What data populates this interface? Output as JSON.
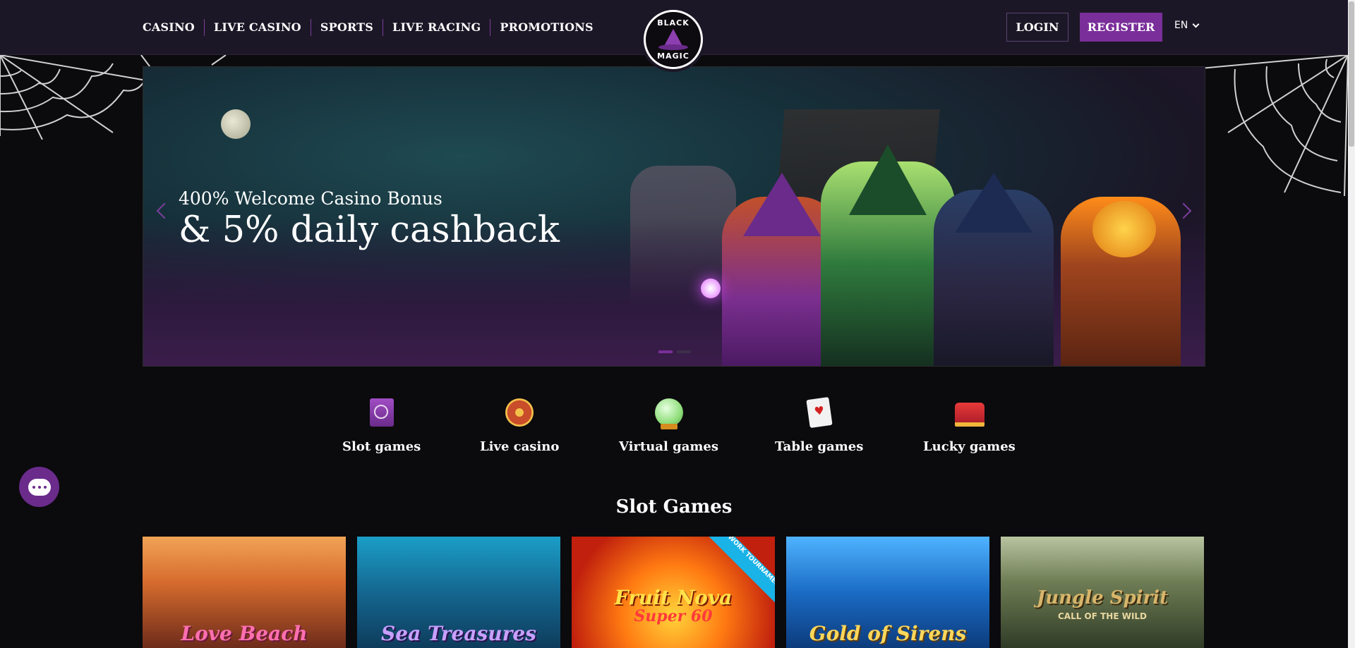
{
  "nav": {
    "items": [
      {
        "label": "CASINO"
      },
      {
        "label": "LIVE CASINO"
      },
      {
        "label": "SPORTS"
      },
      {
        "label": "LIVE RACING"
      },
      {
        "label": "PROMOTIONS"
      }
    ]
  },
  "logo": {
    "top": "BLACK",
    "bottom": "MAGIC"
  },
  "auth": {
    "login_label": "LOGIN",
    "register_label": "REGISTER"
  },
  "language": {
    "selected": "EN"
  },
  "hero": {
    "subtitle": "400% Welcome Casino Bonus",
    "title": "& 5% daily cashback",
    "slide_count": 2,
    "active_slide": 1
  },
  "categories": [
    {
      "label": "Slot games",
      "icon": "spellbook-icon"
    },
    {
      "label": "Live casino",
      "icon": "roulette-wheel-icon"
    },
    {
      "label": "Virtual games",
      "icon": "crystal-ball-icon"
    },
    {
      "label": "Table games",
      "icon": "playing-cards-icon"
    },
    {
      "label": "Lucky games",
      "icon": "crown-icon"
    }
  ],
  "section": {
    "title": "Slot Games"
  },
  "games": [
    {
      "name": "Love Beach"
    },
    {
      "name": "Sea Treasures"
    },
    {
      "name": "Fruit Nova",
      "subname": "Super 60",
      "badge": "NETWORK TOURNAMENT"
    },
    {
      "name": "Gold of Sirens"
    },
    {
      "name": "Jungle Spirit",
      "subname": "CALL OF THE WILD"
    }
  ],
  "colors": {
    "header_bg": "#1c1726",
    "accent": "#7a2e9a",
    "page_bg": "#0b0a0d"
  }
}
